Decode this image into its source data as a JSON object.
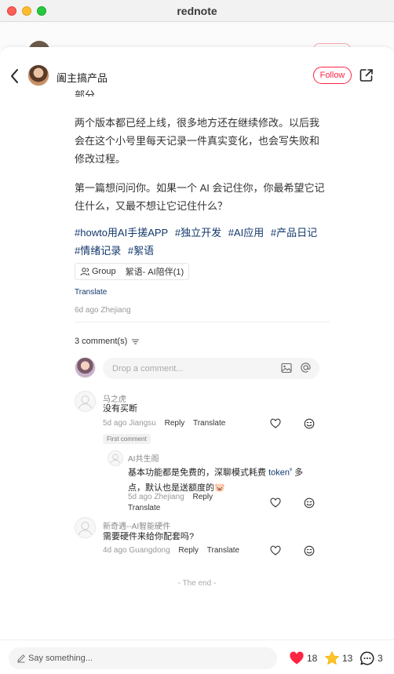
{
  "window": {
    "title": "rednote"
  },
  "header": {
    "author_name": "阖主搞产品",
    "follow_label": "Follow"
  },
  "post": {
    "partial_line": "部分。",
    "paragraph_1": "两个版本都已经上线，很多地方还在继续修改。以后我会在这个小号里每天记录一件真实变化，也会写失败和修改过程。",
    "paragraph_2": "第一篇想问问你。如果一个 AI 会记住你，你最希望它记住什么，又最不想让它记住什么？",
    "hashtags": [
      "#howto用AI手搓APP",
      "#独立开发",
      "#AI应用",
      "#产品日记",
      "#情绪记录",
      "#絮语"
    ],
    "group_label": "Group",
    "group_name": "絮语- AI陪伴(1)",
    "translate_label": "Translate",
    "meta": "6d ago Zhejiang"
  },
  "comments_section": {
    "count_label": "3 comment(s)",
    "input_placeholder": "Drop a comment..."
  },
  "comments": [
    {
      "name": "马之虎",
      "text": "没有买断",
      "meta": "5d ago Jiangsu",
      "reply_label": "Reply",
      "translate_label": "Translate",
      "badge": "First comment"
    },
    {
      "name": "AI共生阁",
      "text_line1": "基本功能都是免费的，深聊模式耗费",
      "token": "token",
      "text_line1_end": "多",
      "text_line2": "点，默认也是送额度的🐷",
      "meta": "5d ago Zhejiang",
      "reply_label": "Reply",
      "translate_label": "Translate"
    },
    {
      "name": "新奇遇--AI智能硬件",
      "text": "需要硬件来给你配套吗?",
      "meta": "4d ago Guangdong",
      "reply_label": "Reply",
      "translate_label": "Translate"
    }
  ],
  "end_label": "- The end -",
  "bottom_bar": {
    "say_placeholder": "Say something...",
    "likes": "18",
    "collects": "13",
    "comments": "3"
  },
  "colors": {
    "accent": "#ff2442",
    "link": "#13386c",
    "star": "#ffc32d"
  }
}
